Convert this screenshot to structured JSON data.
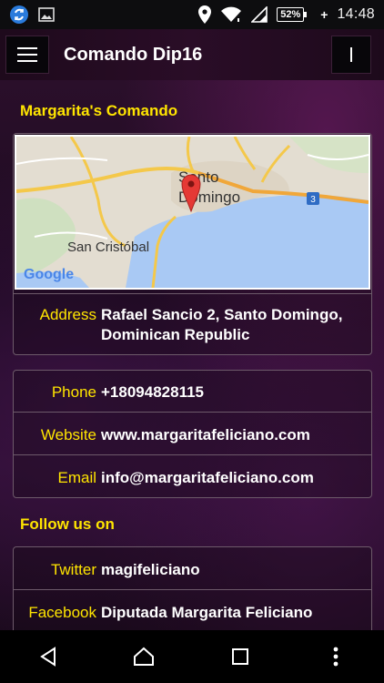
{
  "status_bar": {
    "time": "14:48",
    "battery": "52%",
    "icons": [
      "sync-icon",
      "image-icon",
      "location-icon",
      "wifi-icon",
      "cell-signal-icon",
      "battery-icon"
    ]
  },
  "app_bar": {
    "title": "Comando Dip16"
  },
  "section": {
    "title": "Margarita's Comando"
  },
  "map": {
    "city_label_1": "Santo",
    "city_label_2": "Domingo",
    "city_label_3": "San Cristóbal",
    "highway_shield": "3",
    "brand": "Google"
  },
  "address": {
    "label": "Address",
    "line1": "Rafael Sancio 2, Santo Domingo,",
    "line2": "Dominican Republic"
  },
  "contact": {
    "phone_label": "Phone",
    "phone_value": "+18094828115",
    "website_label": "Website",
    "website_value": "www.margaritafeliciano.com",
    "email_label": "Email",
    "email_value": "info@margaritafeliciano.com"
  },
  "follow": {
    "title": "Follow us on",
    "twitter_label": "Twitter",
    "twitter_value": "magifeliciano",
    "facebook_label": "Facebook",
    "facebook_value": "Diputada Margarita Feliciano"
  },
  "colors": {
    "accent": "#ffe500",
    "background": "#2a0f2a",
    "card_border": "#6d5a6a"
  }
}
